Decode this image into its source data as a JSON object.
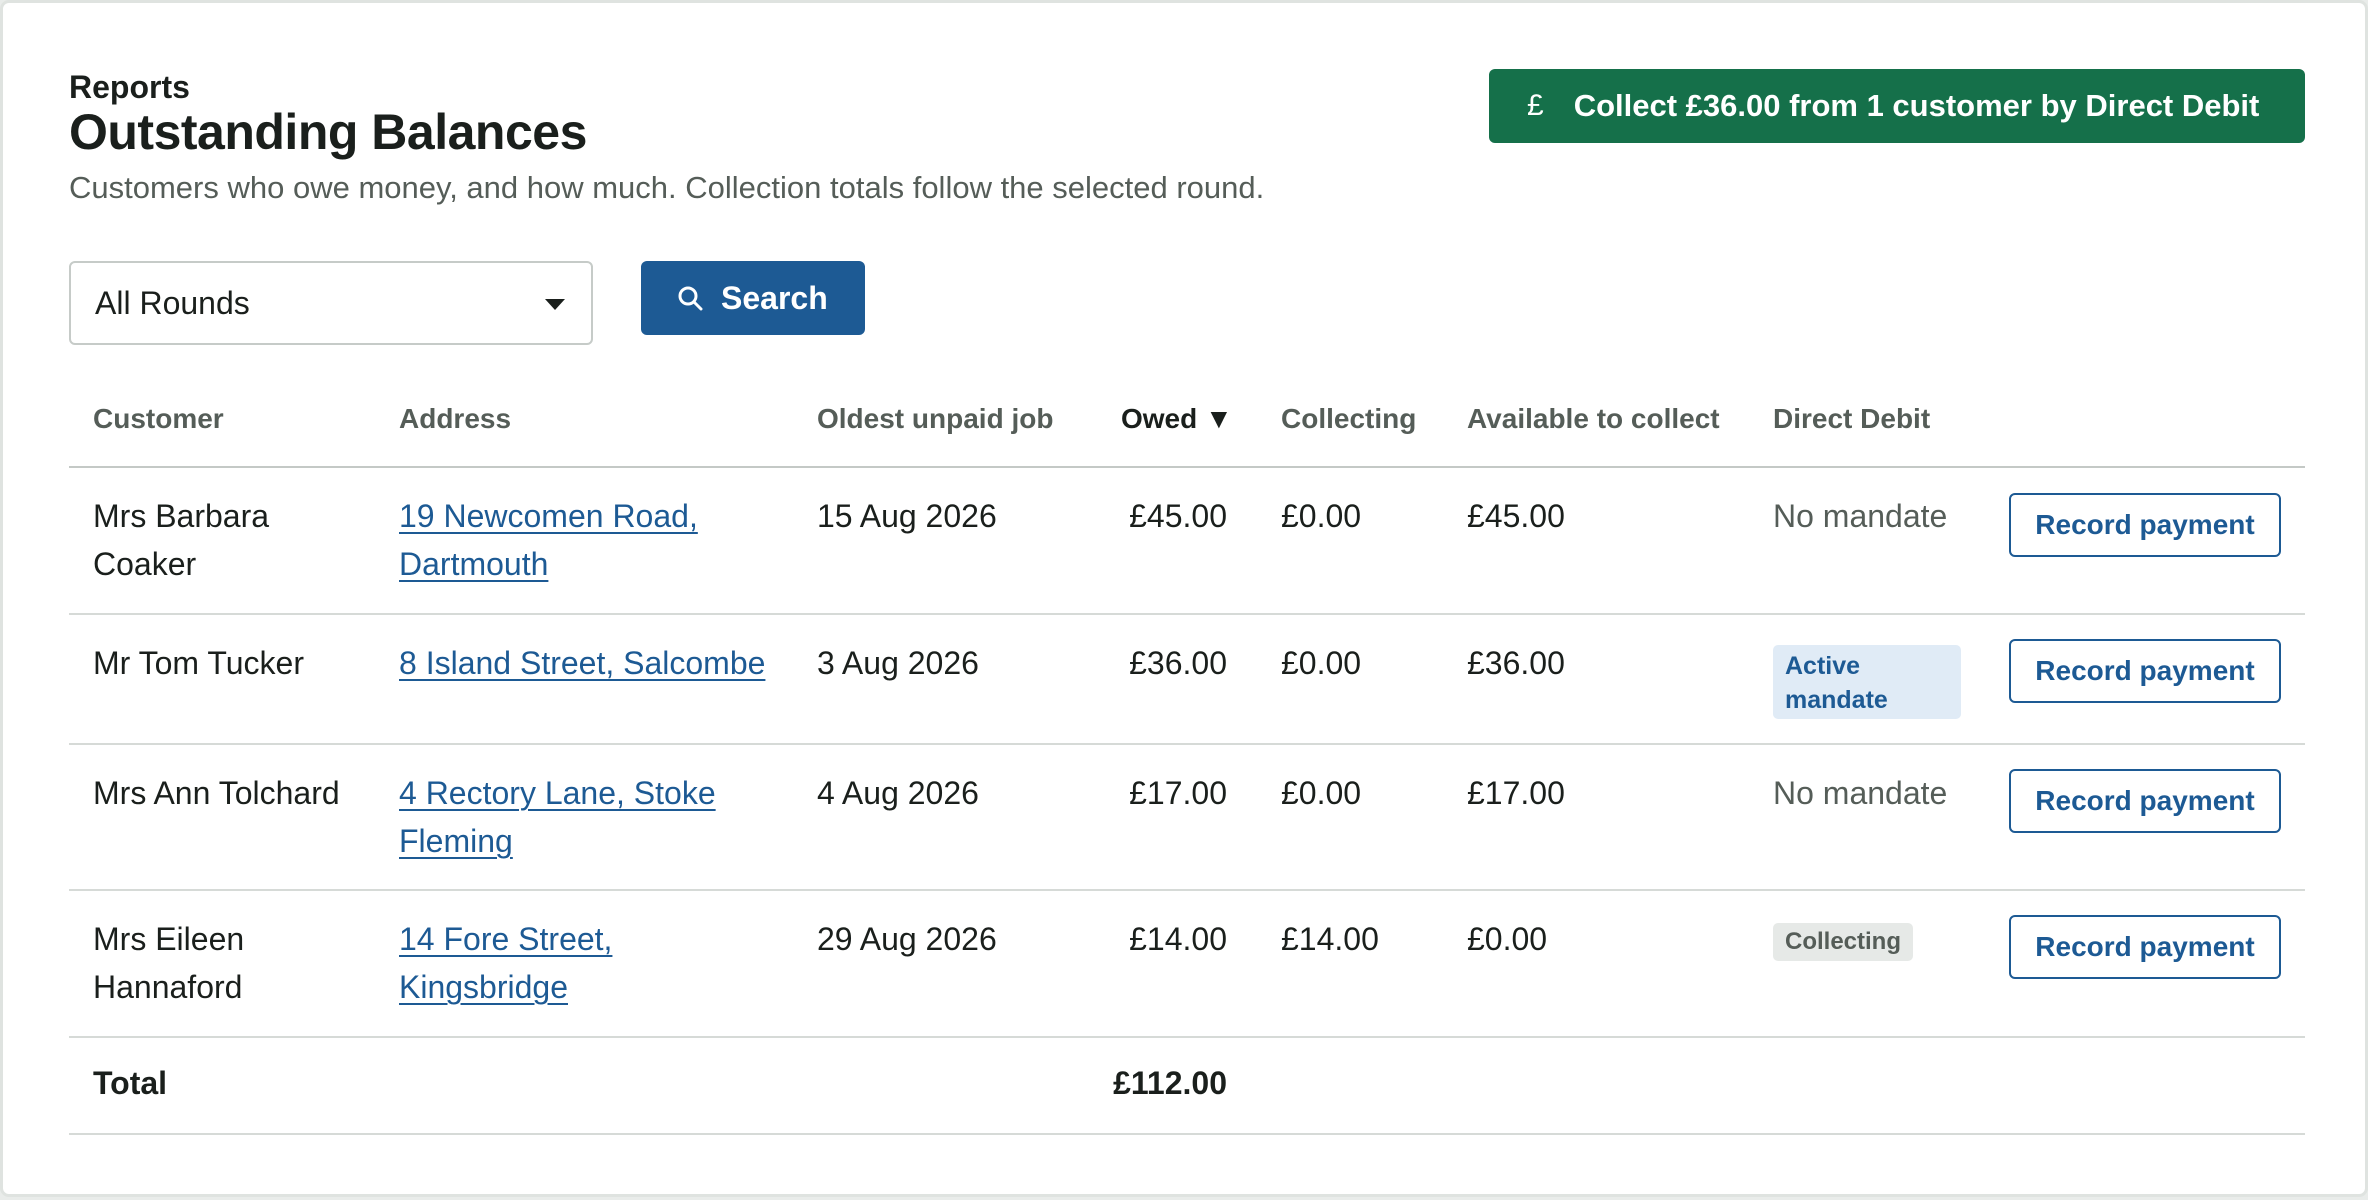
{
  "header": {
    "eyebrow": "Reports",
    "title": "Outstanding Balances",
    "subtitle": "Customers who owe money, and how much. Collection totals follow the selected round."
  },
  "direct_debit_button": {
    "icon": "pound-icon",
    "icon_glyph": "£",
    "label": "Collect £36.00 from 1 customer by Direct Debit",
    "color": "#15704a"
  },
  "filters": {
    "round_selected": "All Rounds",
    "search_label": "Search",
    "search_icon": "search-icon",
    "accent": "#1d5a94"
  },
  "table": {
    "columns": {
      "customer": "Customer",
      "address": "Address",
      "oldest": "Oldest unpaid job",
      "owed": "Owed ▼",
      "collecting": "Collecting",
      "available": "Available to collect",
      "dd": "Direct Debit"
    },
    "rows": [
      {
        "customer": [
          "Mrs Barbara",
          "Coaker"
        ],
        "address": [
          "19 Newcomen Road,",
          "Dartmouth"
        ],
        "oldest": "15 Aug 2026",
        "owed": "£45.00",
        "collecting": "£0.00",
        "available": "£45.00",
        "dd": "No mandate",
        "action": "Record payment"
      },
      {
        "customer": [
          "Mr Tom Tucker"
        ],
        "address": [
          "8 Island Street, Salcombe"
        ],
        "oldest": "3 Aug 2026",
        "owed": "£36.00",
        "collecting": "£0.00",
        "available": "£36.00",
        "dd": [
          "Active",
          "mandate"
        ],
        "action": "Record payment"
      },
      {
        "customer": [
          "Mrs Ann Tolchard"
        ],
        "address": [
          "4 Rectory Lane, Stoke",
          "Fleming"
        ],
        "oldest": "4 Aug 2026",
        "owed": "£17.00",
        "collecting": "£0.00",
        "available": "£17.00",
        "dd": "No mandate",
        "action": "Record payment"
      },
      {
        "customer": [
          "Mrs Eileen",
          "Hannaford"
        ],
        "address": [
          "14 Fore Street,",
          "Kingsbridge"
        ],
        "oldest": "29 Aug 2026",
        "owed": "£14.00",
        "collecting": "£14.00",
        "available": "£0.00",
        "dd": "Collecting",
        "action": "Record payment"
      }
    ],
    "total_label": "Total",
    "total_owed": "£112.00"
  }
}
